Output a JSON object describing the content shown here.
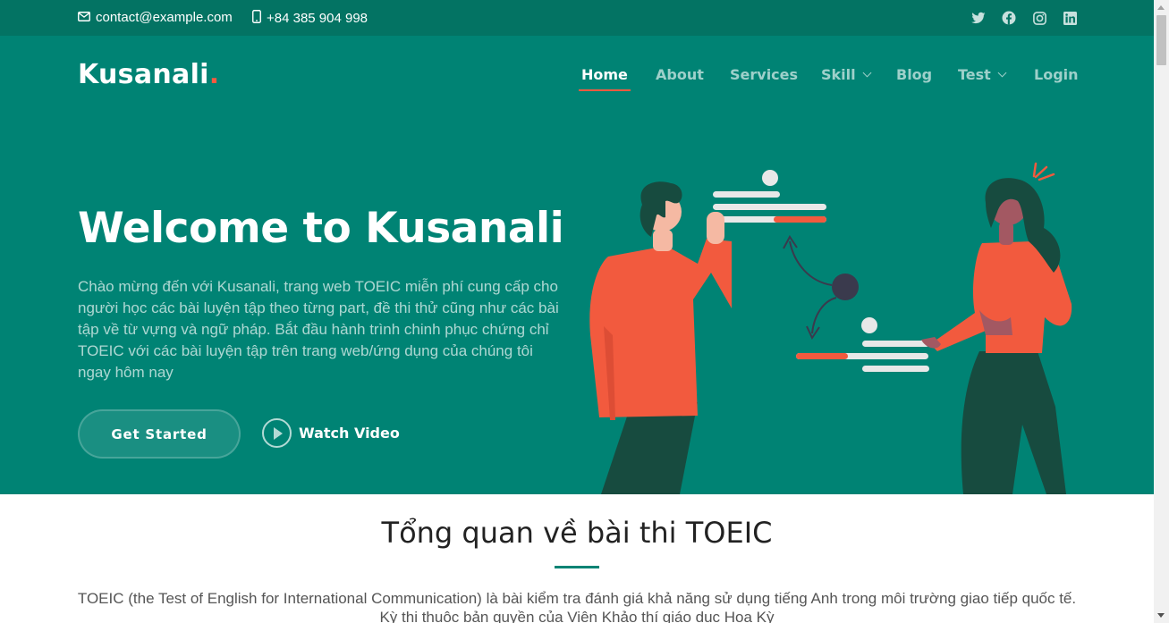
{
  "colors": {
    "primary": "#008374",
    "topbar": "#037363",
    "accent": "#f85a40",
    "white": "#ffffff"
  },
  "topbar": {
    "email": "contact@example.com",
    "phone": "+84 385 904 998",
    "email_icon": "envelope-icon",
    "phone_icon": "phone-icon",
    "social_icons": [
      "twitter-icon",
      "facebook-icon",
      "instagram-icon",
      "linkedin-icon"
    ]
  },
  "header": {
    "logo": "Kusanali",
    "logo_dot": ".",
    "nav": [
      {
        "label": "Home",
        "active": true
      },
      {
        "label": "About"
      },
      {
        "label": "Services"
      },
      {
        "label": "Skill",
        "dropdown": true
      },
      {
        "label": "Blog"
      },
      {
        "label": "Test",
        "dropdown": true
      },
      {
        "label": "Login"
      }
    ]
  },
  "hero": {
    "title": "Welcome to Kusanali",
    "description": "Chào mừng đến với Kusanali, trang web TOEIC miễn phí cung cấp cho người học các bài luyện tập theo từng part, đề thi thử cũng như các bài tập về từ vựng và ngữ pháp. Bắt đầu hành trình chinh phục chứng chỉ TOEIC với các bài luyện tập trên trang web/ứng dụng của chúng tôi ngay hôm nay",
    "cta_label": "Get Started",
    "video_label": "Watch Video"
  },
  "overview": {
    "title": "Tổng quan về bài thi TOEIC",
    "text_line1": "TOEIC (the Test of English for International Communication) là bài kiểm tra đánh giá khả năng sử dụng tiếng Anh trong môi trường giao tiếp quốc tế.",
    "text_line2": "Kỳ thi thuộc bản quyền của Viện Khảo thí giáo dục Hoa Kỳ"
  }
}
